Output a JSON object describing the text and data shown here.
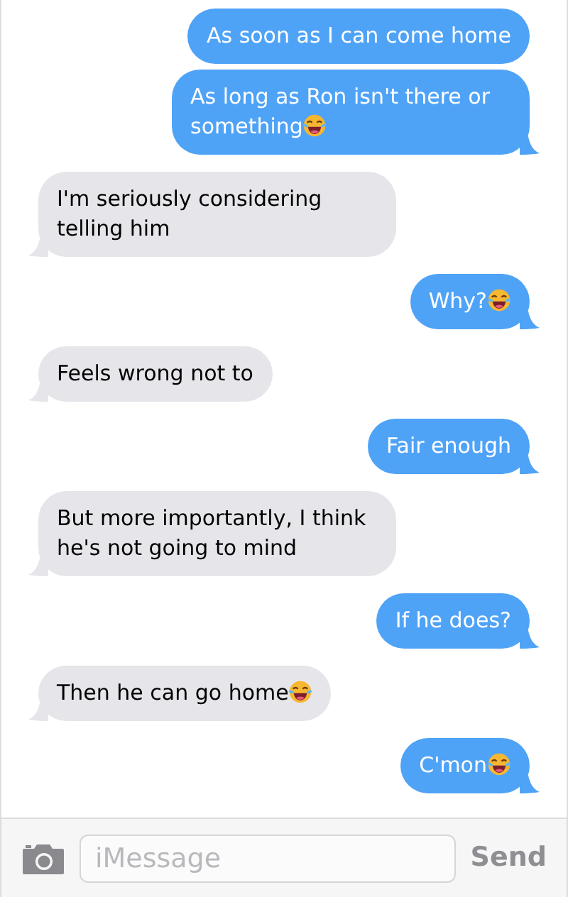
{
  "messages": [
    {
      "kind": "sent",
      "text": "As soon as I can come home",
      "emoji": false,
      "tail": false
    },
    {
      "kind": "sent",
      "text": "As long as Ron isn't there or something",
      "emoji": true,
      "tail": true
    },
    {
      "kind": "received",
      "text": "I'm seriously considering telling him",
      "emoji": false,
      "tail": true
    },
    {
      "kind": "sent",
      "text": "Why?",
      "emoji": true,
      "tail": true
    },
    {
      "kind": "received",
      "text": "Feels wrong not to",
      "emoji": false,
      "tail": true
    },
    {
      "kind": "sent",
      "text": "Fair enough",
      "emoji": false,
      "tail": true
    },
    {
      "kind": "received",
      "text": "But more importantly, I think he's not going to mind",
      "emoji": false,
      "tail": true
    },
    {
      "kind": "sent",
      "text": "If he does?",
      "emoji": false,
      "tail": true
    },
    {
      "kind": "received",
      "text": "Then he can go home",
      "emoji": true,
      "tail": true
    },
    {
      "kind": "sent",
      "text": "C'mon",
      "emoji": true,
      "tail": true
    }
  ],
  "composer": {
    "placeholder": "iMessage",
    "send": "Send"
  }
}
